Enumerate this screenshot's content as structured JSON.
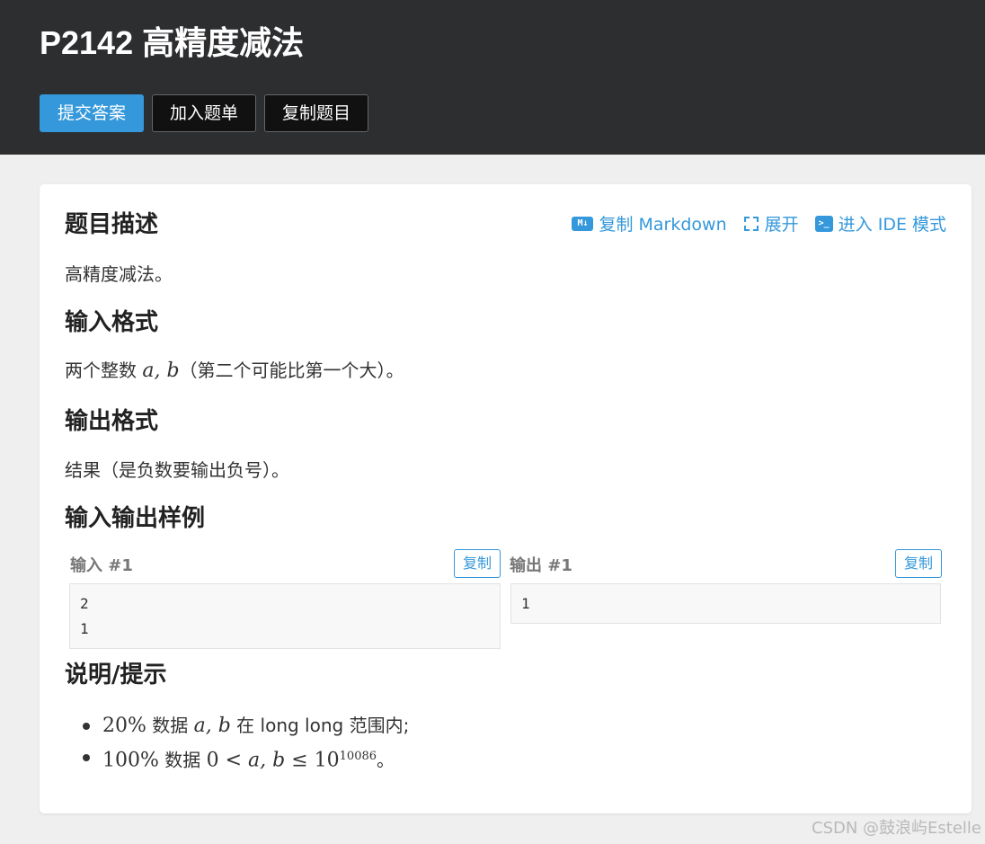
{
  "header": {
    "title": "P2142 高精度减法",
    "buttons": {
      "submit": "提交答案",
      "add_to_list": "加入题单",
      "copy_problem": "复制题目"
    }
  },
  "actions": {
    "copy_markdown": "复制 Markdown",
    "expand": "展开",
    "ide_mode": "进入 IDE 模式",
    "md_icon_text": "M↓",
    "term_icon_text": ">_"
  },
  "sections": {
    "description": {
      "heading": "题目描述",
      "text": "高精度减法。"
    },
    "input_format": {
      "heading": "输入格式",
      "text_pre": "两个整数 ",
      "math": "a, b",
      "text_post": "（第二个可能比第一个大）。"
    },
    "output_format": {
      "heading": "输出格式",
      "text": "结果（是负数要输出负号）。"
    },
    "samples": {
      "heading": "输入输出样例",
      "input_label": "输入 #1",
      "output_label": "输出 #1",
      "copy_label": "复制",
      "input_value": "2\n1",
      "output_value": "1"
    },
    "notes": {
      "heading": "说明/提示",
      "item1": {
        "percent": "20%",
        "pre": " 数据 ",
        "math": "a, b",
        "post": " 在 long long 范围内;"
      },
      "item2": {
        "percent": "100%",
        "pre": " 数据 ",
        "math_a": "0 < ",
        "math_b": "a, b",
        "math_c": " ≤ 10",
        "exponent": "10086",
        "post": "。"
      }
    }
  },
  "watermark": "CSDN @鼓浪屿Estelle",
  "colors": {
    "accent": "#3498db",
    "header_bg": "#2d2e30",
    "page_bg": "#efefef"
  }
}
